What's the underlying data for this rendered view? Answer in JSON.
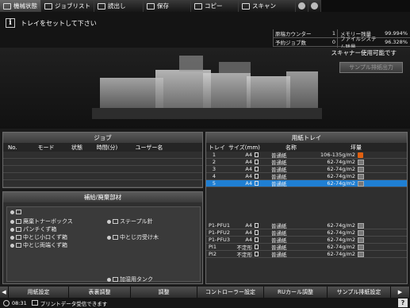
{
  "tabs": [
    {
      "label": "機械状態",
      "icon": "machine-status-icon"
    },
    {
      "label": "ジョブリスト",
      "icon": "job-list-icon"
    },
    {
      "label": "読出し",
      "icon": "recall-icon"
    },
    {
      "label": "保存",
      "icon": "save-icon"
    },
    {
      "label": "コピー",
      "icon": "copy-icon"
    },
    {
      "label": "スキャン",
      "icon": "scan-icon"
    }
  ],
  "message": {
    "text": "トレイをセットして下さい"
  },
  "counters": {
    "row1": {
      "label1": "原稿カウンター",
      "value1": "1",
      "label2": "メモリー残量",
      "value2": "99.994%"
    },
    "row2": {
      "label1": "予約ジョブ数",
      "value1": "0",
      "label2": "ファイルシステム残量",
      "value2": "96.328%"
    }
  },
  "scanner_note": "スキャナー使用可能です",
  "sample_button": "サンプル排紙出力",
  "job_panel": {
    "title": "ジョブ",
    "headers": [
      "No.",
      "モード",
      "状態",
      "時間(分)",
      "ユーザー名"
    ]
  },
  "consumables": {
    "title": "補給/廃棄部材",
    "items": [
      {
        "label": "",
        "icon": "toner-icon"
      },
      {
        "label": "廃棄トナーボックス",
        "icon": "waste-toner-icon"
      },
      {
        "label": "パンチくず箱",
        "icon": "punch-icon"
      },
      {
        "label": "中とじ小口くず箱",
        "icon": "trim-icon"
      },
      {
        "label": "中とじ両端くず箱",
        "icon": "trim-end-icon"
      },
      {
        "label": "ステープル針",
        "icon": "staple-icon"
      },
      {
        "label": "中とじ刃受け木",
        "icon": "blade-icon"
      },
      {
        "label": "加湿用タンク",
        "icon": "tank-icon"
      }
    ]
  },
  "tray_panel": {
    "title": "用紙トレイ",
    "headers": [
      "トレイ",
      "サイズ(mm)",
      "名称",
      "坪量"
    ],
    "trays": [
      {
        "tray": "1",
        "size": "A4",
        "name": "普通紙",
        "weight": "106-135g/m2",
        "status": "warn"
      },
      {
        "tray": "2",
        "size": "A4",
        "name": "普通紙",
        "weight": "62-74g/m2",
        "status": "box"
      },
      {
        "tray": "3",
        "size": "A4",
        "name": "普通紙",
        "weight": "62-74g/m2",
        "status": "box"
      },
      {
        "tray": "4",
        "size": "A4",
        "name": "普通紙",
        "weight": "62-74g/m2",
        "status": "box"
      },
      {
        "tray": "5",
        "size": "A4",
        "name": "普通紙",
        "weight": "62-74g/m2",
        "status": "box"
      }
    ],
    "pfu": [
      {
        "tray": "P1-PFU1",
        "size": "A4",
        "name": "普通紙",
        "weight": "62-74g/m2"
      },
      {
        "tray": "P1-PFU2",
        "size": "A4",
        "name": "普通紙",
        "weight": "62-74g/m2"
      },
      {
        "tray": "P1-PFU3",
        "size": "A4",
        "name": "普通紙",
        "weight": "62-74g/m2"
      },
      {
        "tray": "PI1",
        "size": "不定形",
        "name": "普通紙",
        "weight": "62-74g/m2"
      },
      {
        "tray": "PI2",
        "size": "不定形",
        "name": "普通紙",
        "weight": "62-74g/m2"
      }
    ]
  },
  "bottom_buttons": [
    "用紙設定",
    "表裏調整",
    "調整",
    "コントローラー設定",
    "RUカール調整",
    "サンプル排紙設定"
  ],
  "status": {
    "time": "08:31",
    "text": "プリントデータ受信できます"
  }
}
